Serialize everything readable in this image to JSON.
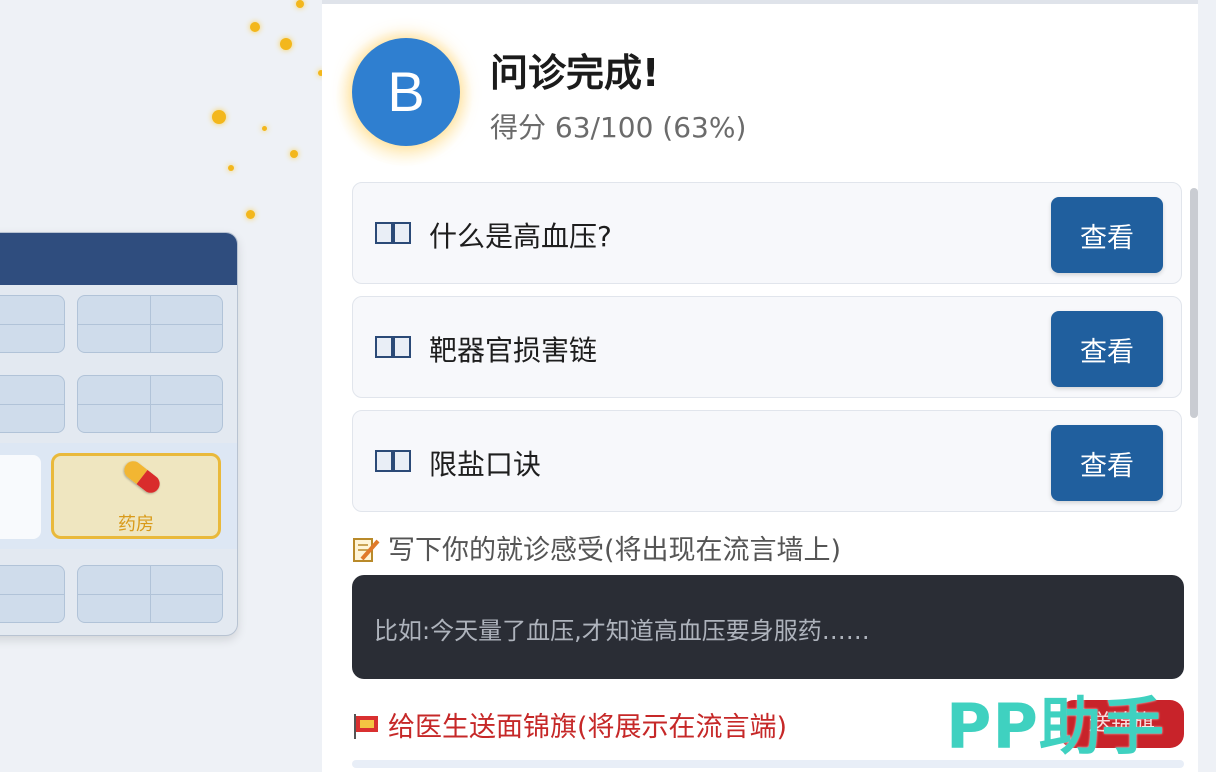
{
  "game": {
    "medicine_slot_label": "药房"
  },
  "result": {
    "avatar_letter": "B",
    "title": "问诊完成!",
    "score_text": "得分 63/100 (63%)",
    "score": 63,
    "score_max": 100
  },
  "topics": [
    {
      "label": "什么是高血压?",
      "button": "查看"
    },
    {
      "label": "靶器官损害链",
      "button": "查看"
    },
    {
      "label": "限盐口诀",
      "button": "查看"
    }
  ],
  "feedback": {
    "label": "写下你的就诊感受(将出现在流言墙上)",
    "placeholder": "比如:今天量了血压,才知道高血压要身服药……"
  },
  "banner": {
    "label": "给医生送面锦旗(将展示在流言端)",
    "button": "送锦旗"
  },
  "watermark": "PP助手",
  "colors": {
    "primary_button": "#205f9e",
    "banner_red": "#c62828",
    "avatar_blue": "#2f7fd0",
    "input_dark": "#2a2d35",
    "sparkle_gold": "#f3b71c"
  }
}
